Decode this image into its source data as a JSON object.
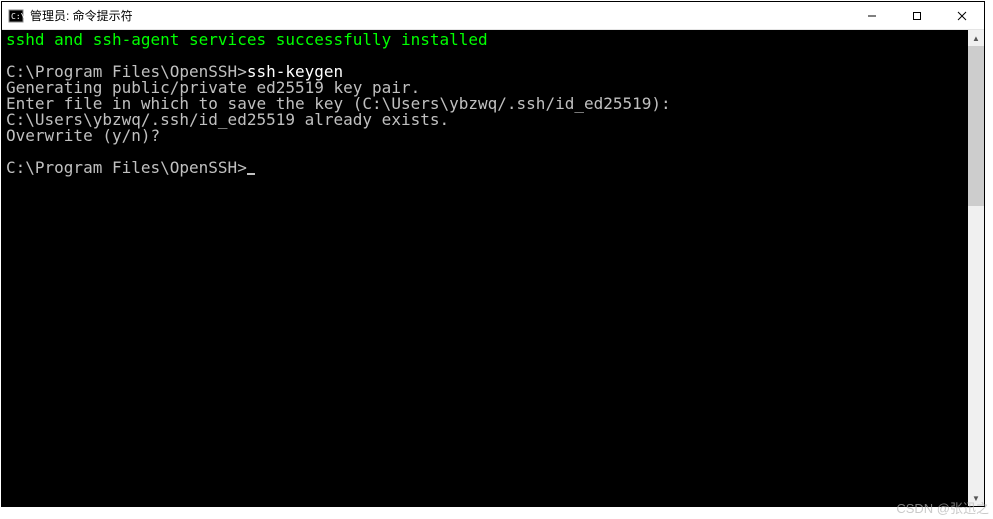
{
  "window": {
    "title": "管理员: 命令提示符"
  },
  "terminal": {
    "line_success": "sshd and ssh-agent services successfully installed",
    "prompt1": "C:\\Program Files\\OpenSSH>",
    "cmd1": "ssh-keygen",
    "line_gen": "Generating public/private ed25519 key pair.",
    "line_enter": "Enter file in which to save the key (C:\\Users\\ybzwq/.ssh/id_ed25519):",
    "line_exists": "C:\\Users\\ybzwq/.ssh/id_ed25519 already exists.",
    "line_overwrite": "Overwrite (y/n)?",
    "prompt2": "C:\\Program Files\\OpenSSH>"
  },
  "watermark": "CSDN @张迅之"
}
